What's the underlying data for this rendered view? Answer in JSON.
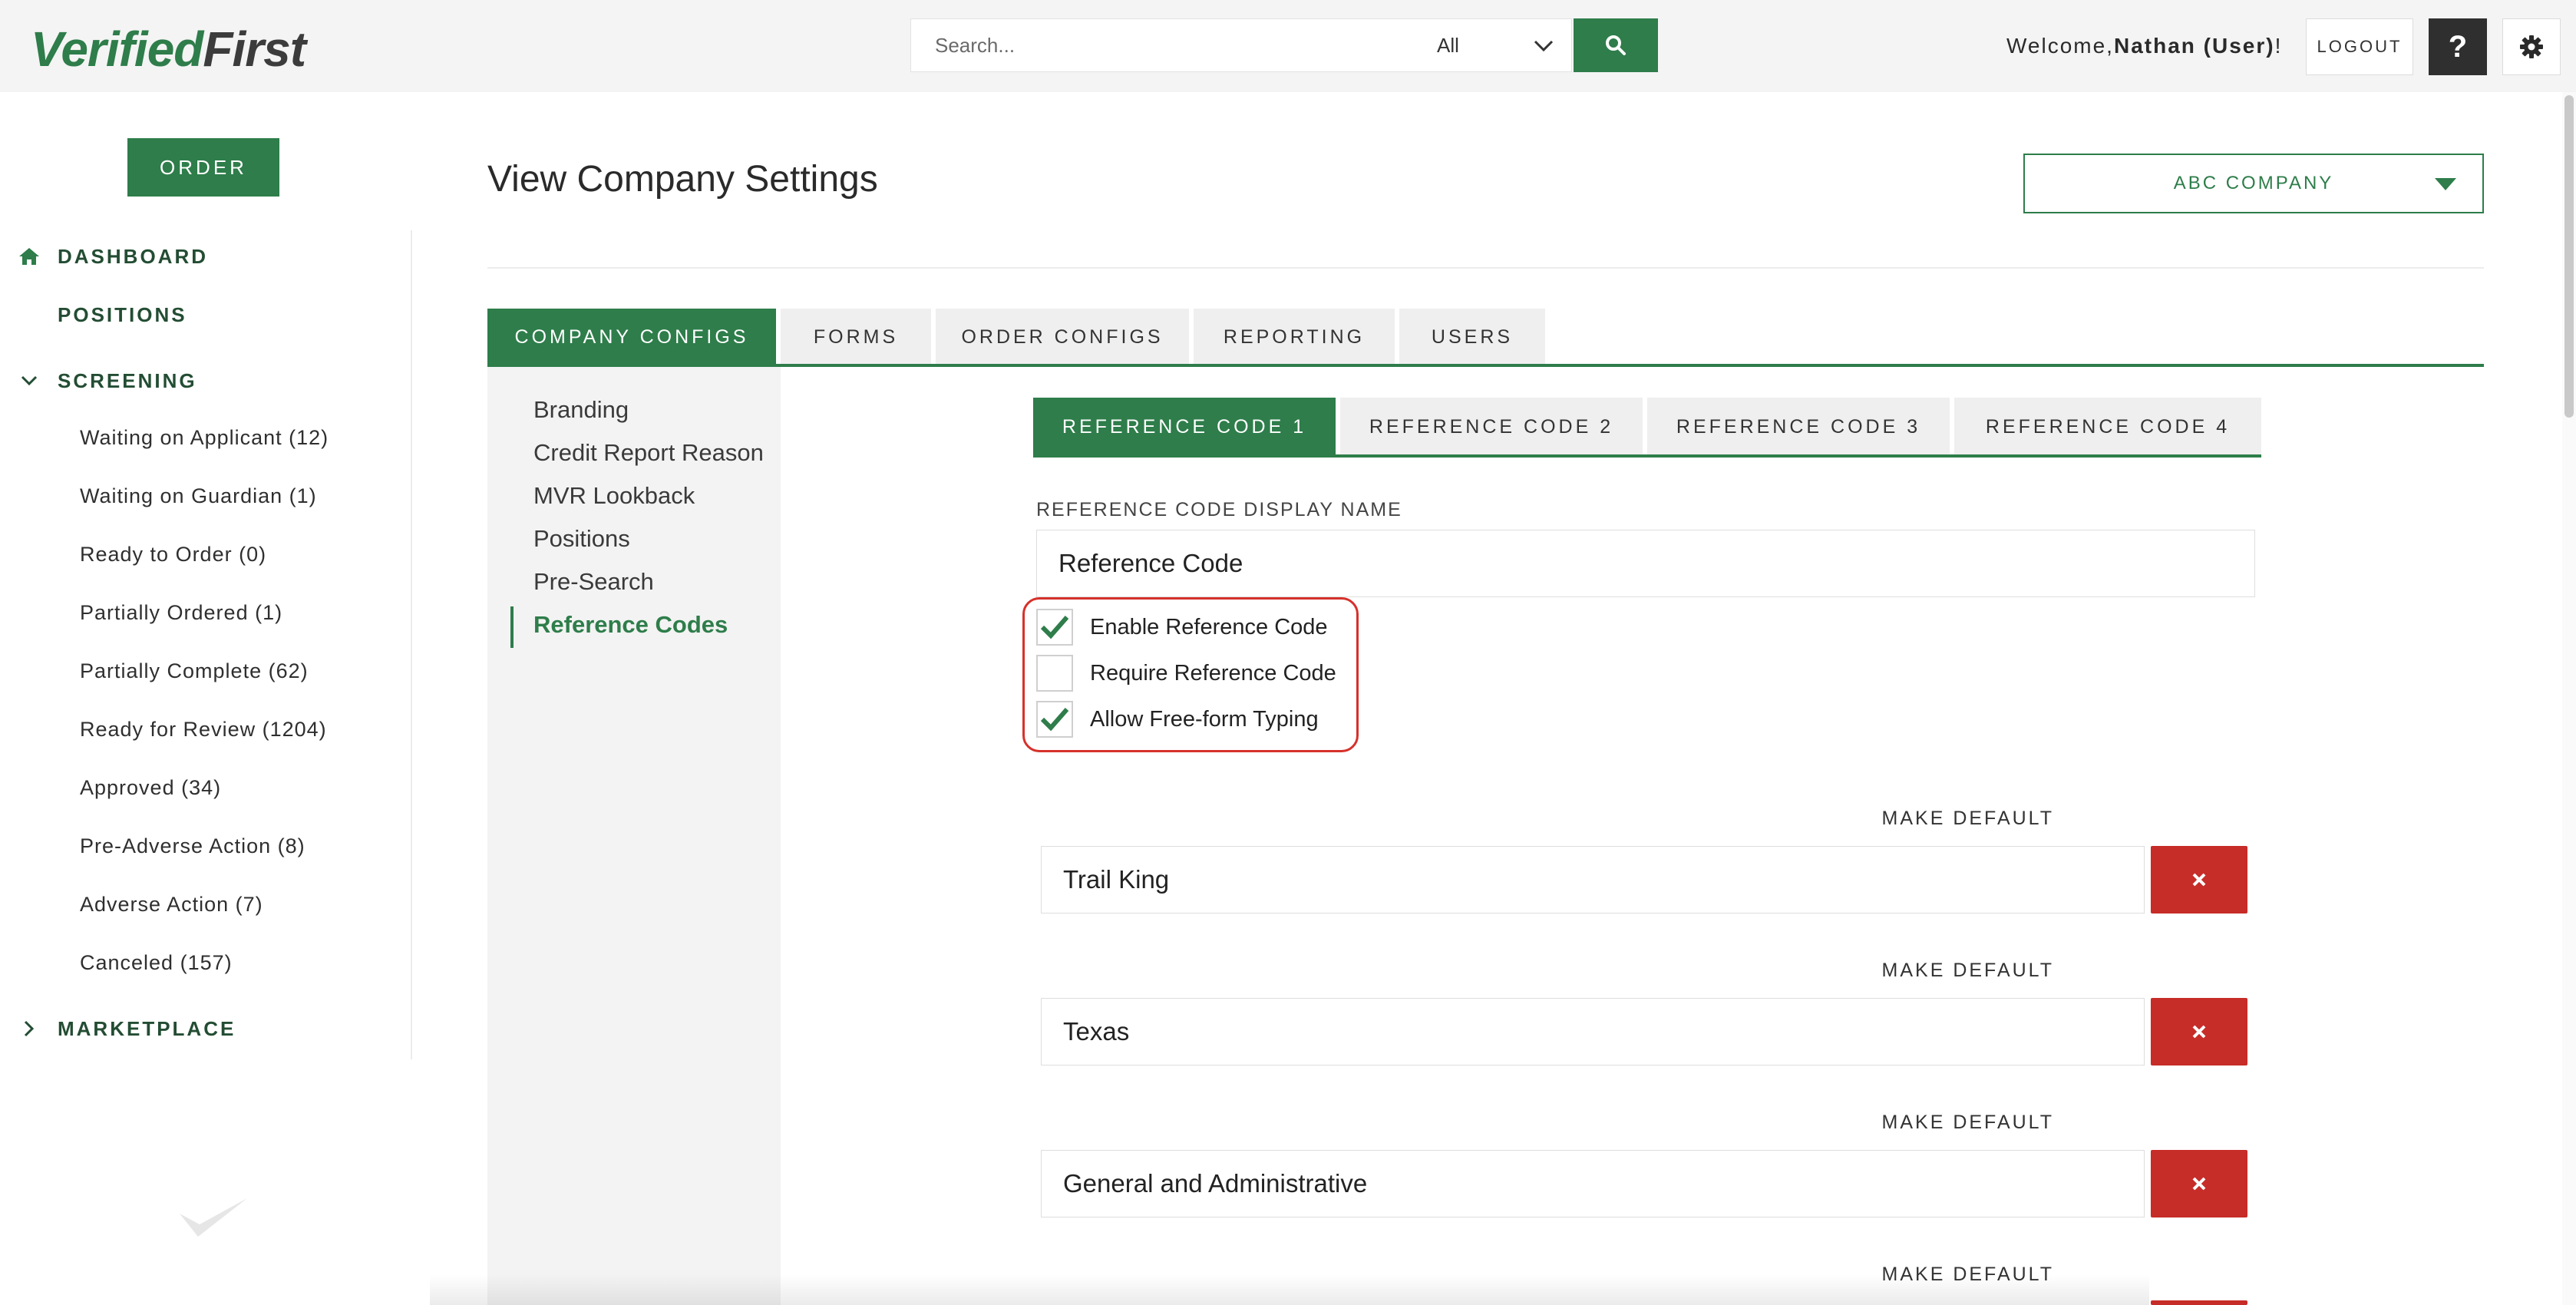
{
  "header": {
    "logo": {
      "part1": "Verified",
      "part2": "First"
    },
    "search": {
      "placeholder": "Search...",
      "filter": "All"
    },
    "welcome": {
      "prefix": "Welcome,",
      "user": "Nathan (User)",
      "suffix": "!"
    },
    "logout_label": "LOGOUT",
    "help_label": "?"
  },
  "sidebar": {
    "order_label": "ORDER",
    "dashboard": "DASHBOARD",
    "positions": "POSITIONS",
    "screening": "SCREENING",
    "screening_items": [
      "Waiting on Applicant (12)",
      "Waiting on Guardian (1)",
      "Ready to Order (0)",
      "Partially Ordered (1)",
      "Partially Complete (62)",
      "Ready for Review (1204)",
      "Approved (34)",
      "Pre-Adverse Action (8)",
      "Adverse Action (7)",
      "Canceled (157)"
    ],
    "marketplace": "MARKETPLACE"
  },
  "main": {
    "title": "View Company Settings",
    "company": "ABC COMPANY",
    "tabs": [
      "COMPANY CONFIGS",
      "FORMS",
      "ORDER CONFIGS",
      "REPORTING",
      "USERS"
    ],
    "subnav": [
      "Branding",
      "Credit Report Reason",
      "MVR Lookback",
      "Positions",
      "Pre-Search",
      "Reference Codes"
    ],
    "ref_tabs": [
      "REFERENCE CODE 1",
      "REFERENCE CODE 2",
      "REFERENCE CODE 3",
      "REFERENCE CODE 4"
    ],
    "display_name_label": "REFERENCE CODE DISPLAY NAME",
    "display_name_value": "Reference Code",
    "checkboxes": [
      {
        "label": "Enable Reference Code",
        "checked": true
      },
      {
        "label": "Require Reference Code",
        "checked": false
      },
      {
        "label": "Allow Free-form Typing",
        "checked": true
      }
    ],
    "make_default_label": "MAKE DEFAULT",
    "codes": [
      "Trail King",
      "Texas",
      "General and Administrative"
    ],
    "delete_symbol": "×"
  },
  "colors": {
    "brand_green": "#2e7d4a",
    "danger_red": "#c62c28",
    "highlight_red": "#d6312b"
  }
}
